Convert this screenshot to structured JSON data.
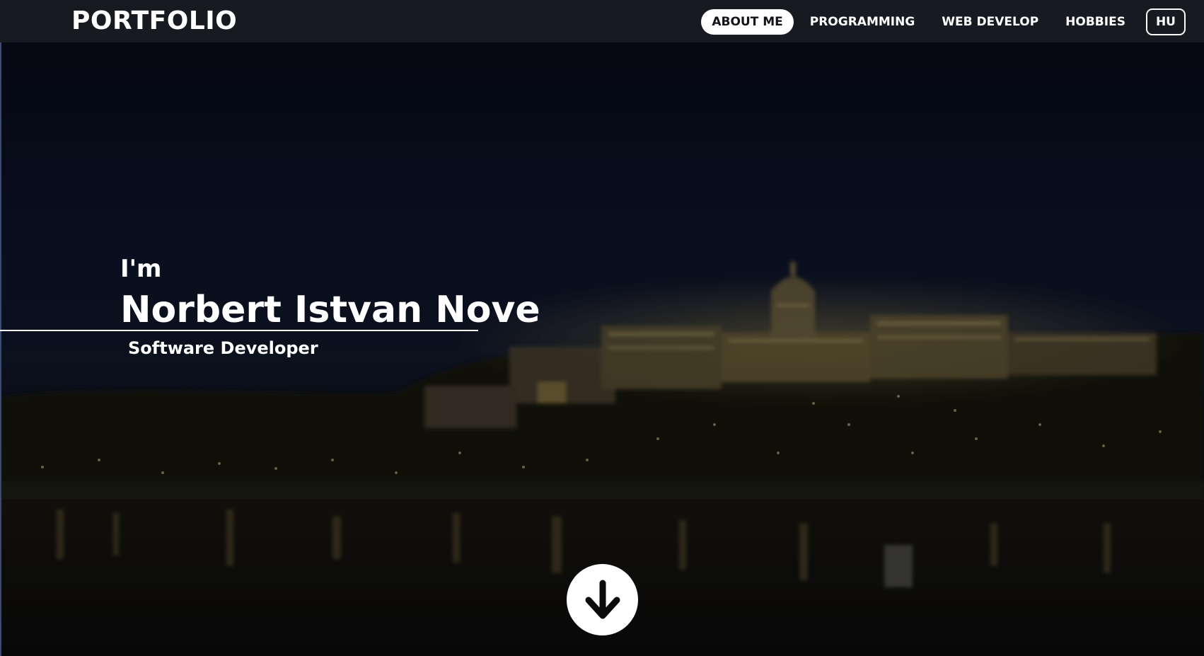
{
  "header": {
    "brand": "PORTFOLIO"
  },
  "nav": {
    "items": [
      {
        "label": "ABOUT ME",
        "active": true
      },
      {
        "label": "PROGRAMMING",
        "active": false
      },
      {
        "label": "WEB DEVELOP",
        "active": false
      },
      {
        "label": "HOBBIES",
        "active": false
      }
    ],
    "language_button": "HU"
  },
  "hero": {
    "intro": "I'm",
    "name": "Norbert Istvan Nove",
    "role": "Software Developer",
    "scroll_icon": "arrow-down-circle-icon",
    "background": "night-city-castle-river-image"
  },
  "colors": {
    "navbar_bg": "#181a22",
    "active_pill_bg": "#ffffff",
    "text": "#ffffff"
  }
}
